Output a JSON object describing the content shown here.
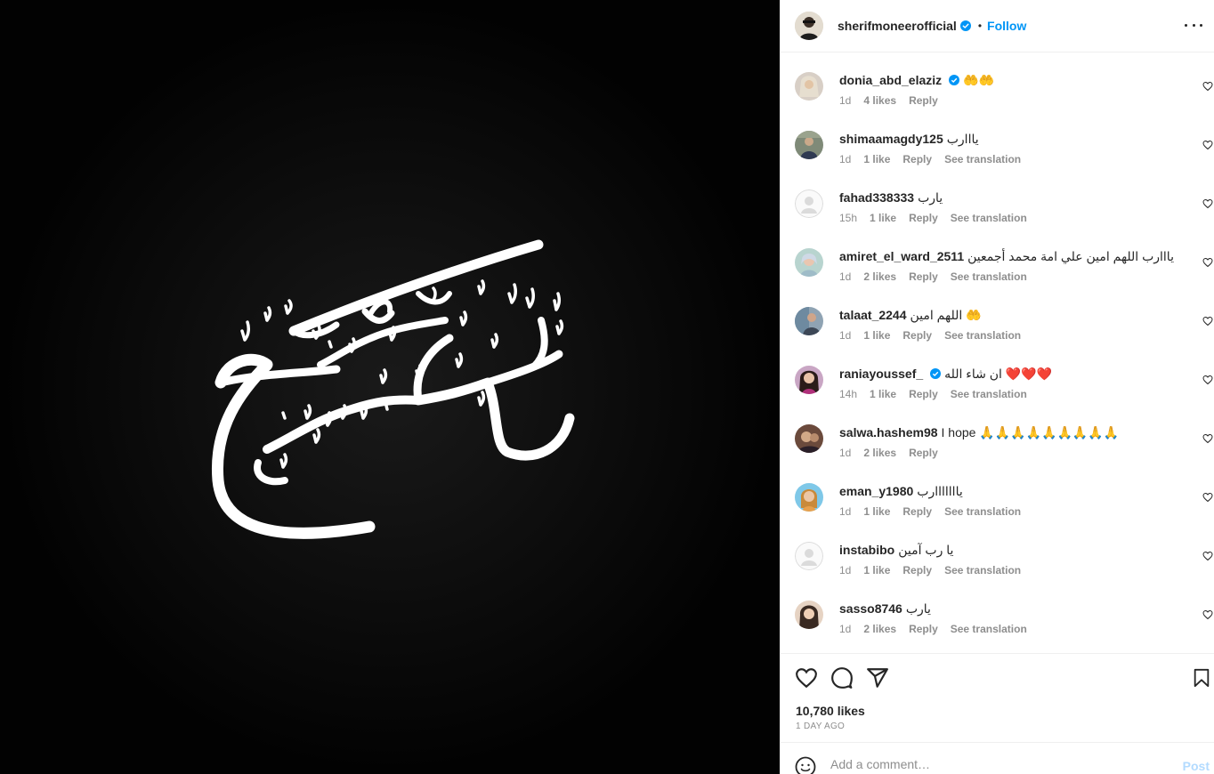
{
  "post": {
    "author": "sherifmoneerofficial",
    "follow_label": "Follow",
    "separator": "•",
    "image_text": "ستفرج",
    "likes": "10,780 likes",
    "time_ago": "1 DAY AGO"
  },
  "comments": [
    {
      "user": "donia_abd_elaziz",
      "verified": true,
      "text": "🤲🤲",
      "time": "1d",
      "likes": "4 likes",
      "reply": "Reply",
      "translate": ""
    },
    {
      "user": "shimaamagdy125",
      "verified": false,
      "text": "يااارب",
      "time": "1d",
      "likes": "1 like",
      "reply": "Reply",
      "translate": "See translation"
    },
    {
      "user": "fahad338333",
      "verified": false,
      "text": "يارب",
      "time": "15h",
      "likes": "1 like",
      "reply": "Reply",
      "translate": "See translation"
    },
    {
      "user": "amiret_el_ward_2511",
      "verified": false,
      "text": "يااارب اللهم امين علي امة محمد أجمعين",
      "time": "1d",
      "likes": "2 likes",
      "reply": "Reply",
      "translate": "See translation"
    },
    {
      "user": "talaat_2244",
      "verified": false,
      "text": "اللهم امين 🤲",
      "time": "1d",
      "likes": "1 like",
      "reply": "Reply",
      "translate": "See translation"
    },
    {
      "user": "raniayoussef_",
      "verified": true,
      "text": "ان شاء الله ❤️❤️❤️",
      "time": "14h",
      "likes": "1 like",
      "reply": "Reply",
      "translate": "See translation"
    },
    {
      "user": "salwa.hashem98",
      "verified": false,
      "text": "I hope 🙏🙏🙏🙏🙏🙏🙏🙏🙏",
      "time": "1d",
      "likes": "2 likes",
      "reply": "Reply",
      "translate": ""
    },
    {
      "user": "eman_y1980",
      "verified": false,
      "text": "يااااااارب",
      "time": "1d",
      "likes": "1 like",
      "reply": "Reply",
      "translate": "See translation"
    },
    {
      "user": "instabibo",
      "verified": false,
      "text": "يا رب آمين",
      "time": "1d",
      "likes": "1 like",
      "reply": "Reply",
      "translate": "See translation"
    },
    {
      "user": "sasso8746",
      "verified": false,
      "text": "يارب",
      "time": "1d",
      "likes": "2 likes",
      "reply": "Reply",
      "translate": "See translation"
    }
  ],
  "add_comment": {
    "placeholder": "Add a comment…",
    "post_label": "Post"
  },
  "colors": {
    "accent": "#0095f6",
    "muted": "#8e8e8e",
    "text": "#262626",
    "media_bg": "#020202"
  },
  "icons": [
    "verified-icon",
    "more-icon",
    "heart-icon",
    "comment-icon",
    "share-icon",
    "bookmark-icon",
    "emoji-icon"
  ]
}
